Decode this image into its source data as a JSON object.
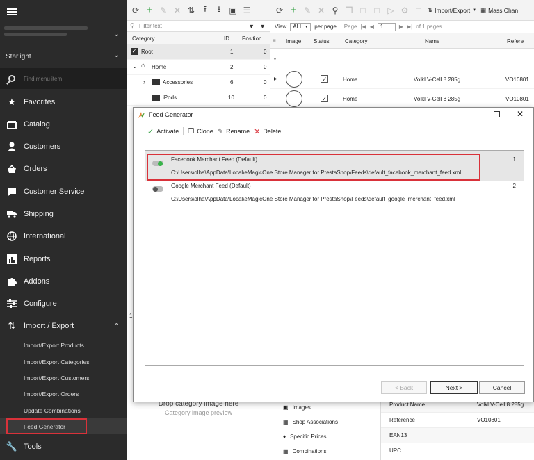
{
  "sidebar": {
    "shop_name": "Starlight",
    "search_placeholder": "Find menu item",
    "items": [
      {
        "label": "Favorites",
        "icon": "star-icon"
      },
      {
        "label": "Catalog",
        "icon": "catalog-icon"
      },
      {
        "label": "Customers",
        "icon": "user-icon"
      },
      {
        "label": "Orders",
        "icon": "basket-icon"
      },
      {
        "label": "Customer Service",
        "icon": "chat-icon"
      },
      {
        "label": "Shipping",
        "icon": "truck-icon"
      },
      {
        "label": "International",
        "icon": "globe-icon"
      },
      {
        "label": "Reports",
        "icon": "chart-icon"
      },
      {
        "label": "Addons",
        "icon": "puzzle-icon"
      },
      {
        "label": "Configure",
        "icon": "sliders-icon"
      },
      {
        "label": "Import / Export",
        "icon": "import-export-icon"
      }
    ],
    "sub_items": [
      "Import/Export Products",
      "Import/Export Categories",
      "Import/Export Customers",
      "Import/Export Orders",
      "Update Combinations",
      "Feed Generator"
    ],
    "tools_label": "Tools",
    "highlight_color": "#d9323a"
  },
  "category_panel": {
    "filter_placeholder": "Filter text",
    "columns": [
      "Category",
      "ID",
      "Position"
    ],
    "rows": [
      {
        "name": "Root",
        "id": "1",
        "position": "0"
      },
      {
        "name": "Home",
        "id": "2",
        "position": "0"
      },
      {
        "name": "Accessories",
        "id": "6",
        "position": "0"
      },
      {
        "name": "iPods",
        "id": "10",
        "position": "0"
      }
    ],
    "drop_text": "Drop category image here",
    "preview_text": "Category image preview",
    "side_number": "1"
  },
  "product_panel": {
    "toolbar": {
      "import_export": "Import/Export",
      "mass_change": "Mass Chan"
    },
    "paging": {
      "view_label": "View",
      "view_value": "ALL",
      "per_page": "per page",
      "page_label": "Page",
      "page_value": "1",
      "of_pages": "of 1 pages"
    },
    "columns": [
      "Image",
      "Status",
      "Category",
      "Name",
      "Refere"
    ],
    "rows": [
      {
        "category": "Home",
        "name": "Volkl V-Cell 8 285g",
        "reference": "VO10801"
      },
      {
        "category": "Home",
        "name": "Volkl V-Cell 8 285g",
        "reference": "VO10801"
      }
    ],
    "detail_links": [
      "Images",
      "Shop Associations",
      "Specific Prices",
      "Combinations"
    ],
    "detail_fields": [
      {
        "label": "Product Name",
        "value": "Volkl V-Cell 8 285g"
      },
      {
        "label": "Reference",
        "value": "VO10801"
      },
      {
        "label": "EAN13",
        "value": ""
      },
      {
        "label": "UPC",
        "value": ""
      }
    ]
  },
  "dialog": {
    "title": "Feed Generator",
    "toolbar": {
      "activate": "Activate",
      "clone": "Clone",
      "rename": "Rename",
      "delete": "Delete"
    },
    "feeds": [
      {
        "name": "Facebook Merchant Feed (Default)",
        "path": "C:\\Users\\olha\\AppData\\Local\\eMagicOne Store Manager for PrestaShop\\Feeds\\default_facebook_merchant_feed.xml",
        "num": "1",
        "active": true
      },
      {
        "name": "Google Merchant Feed (Default)",
        "path": "C:\\Users\\olha\\AppData\\Local\\eMagicOne Store Manager for PrestaShop\\Feeds\\default_google_merchant_feed.xml",
        "num": "2",
        "active": false
      }
    ],
    "buttons": {
      "back": "< Back",
      "next": "Next >",
      "cancel": "Cancel"
    }
  }
}
